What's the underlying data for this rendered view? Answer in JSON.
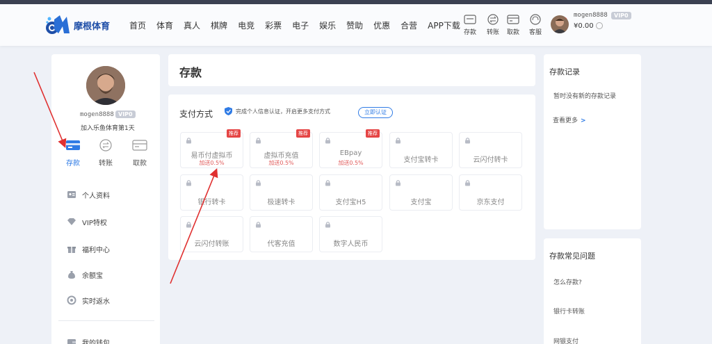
{
  "header": {
    "logo_text": "摩根体育",
    "nav": [
      "首页",
      "体育",
      "真人",
      "棋牌",
      "电竞",
      "彩票",
      "电子",
      "娱乐",
      "赞助",
      "优惠",
      "合营",
      "APP下载"
    ],
    "quick_actions": [
      "存款",
      "转账",
      "取款",
      "客服"
    ],
    "username": "mogen8888",
    "vip": "VIP0",
    "balance": "¥0.00"
  },
  "sidebar": {
    "username": "mogen8888",
    "vip": "VIP0",
    "joined": "加入乐鱼体育第1天",
    "actions": [
      "存款",
      "转账",
      "取款"
    ],
    "menu": [
      "个人资料",
      "VIP特权",
      "福利中心",
      "余额宝",
      "实时返水",
      "我的钱包"
    ]
  },
  "main": {
    "title": "存款",
    "pay_title": "支付方式",
    "verify_note": "完成个人信息认证，开启更多支付方式",
    "verify_button": "立即认证",
    "methods": [
      {
        "name": "易币付虚拟币",
        "rate": "加送0.5%",
        "badge": "推荐"
      },
      {
        "name": "虚拟币充值",
        "rate": "加送0.5%",
        "badge": "推荐"
      },
      {
        "name": "EBpay",
        "rate": "加送0.5%",
        "badge": "推荐"
      },
      {
        "name": "支付宝转卡"
      },
      {
        "name": "云闪付转卡"
      },
      {
        "name": "银行转卡"
      },
      {
        "name": "极速转卡"
      },
      {
        "name": "支付宝H5"
      },
      {
        "name": "支付宝"
      },
      {
        "name": "京东支付"
      },
      {
        "name": "云闪付转账"
      },
      {
        "name": "代客充值"
      },
      {
        "name": "数字人民币"
      }
    ]
  },
  "right": {
    "records_title": "存款记录",
    "no_records": "暂时没有新的存款记录",
    "see_more": "查看更多",
    "faq_title": "存款常见问题",
    "faq": [
      "怎么存款?",
      "银行卡转账",
      "网银支付"
    ]
  },
  "colors": {
    "accent": "#2f7be5",
    "badge": "#e54545",
    "annotation_arrow": "#e03030"
  }
}
